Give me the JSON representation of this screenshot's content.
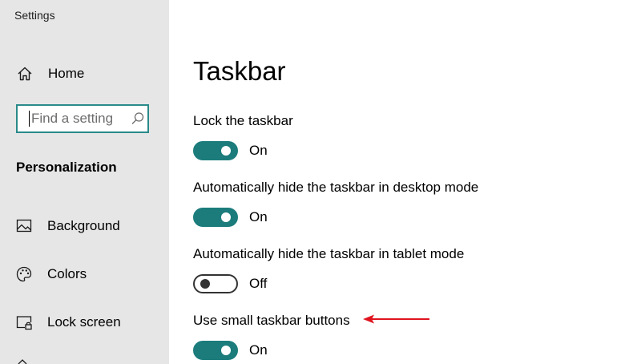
{
  "window": {
    "title": "Settings"
  },
  "sidebar": {
    "home": {
      "label": "Home",
      "icon": "home-icon"
    },
    "search": {
      "placeholder": "Find a setting",
      "value": "",
      "icon": "search-icon"
    },
    "section_title": "Personalization",
    "items": [
      {
        "label": "Background",
        "icon": "image-icon"
      },
      {
        "label": "Colors",
        "icon": "palette-icon"
      },
      {
        "label": "Lock screen",
        "icon": "lock-screen-icon"
      }
    ]
  },
  "main": {
    "title": "Taskbar",
    "settings": [
      {
        "label": "Lock the taskbar",
        "state": "On"
      },
      {
        "label": "Automatically hide the taskbar in desktop mode",
        "state": "On"
      },
      {
        "label": "Automatically hide the taskbar in tablet mode",
        "state": "Off"
      },
      {
        "label": "Use small taskbar buttons",
        "state": "On"
      }
    ]
  },
  "colors": {
    "sidebar_bg": "#e6e6e6",
    "accent": "#1c7c7c",
    "search_border": "#2a8a8a",
    "annotation_arrow": "#e0141e"
  }
}
